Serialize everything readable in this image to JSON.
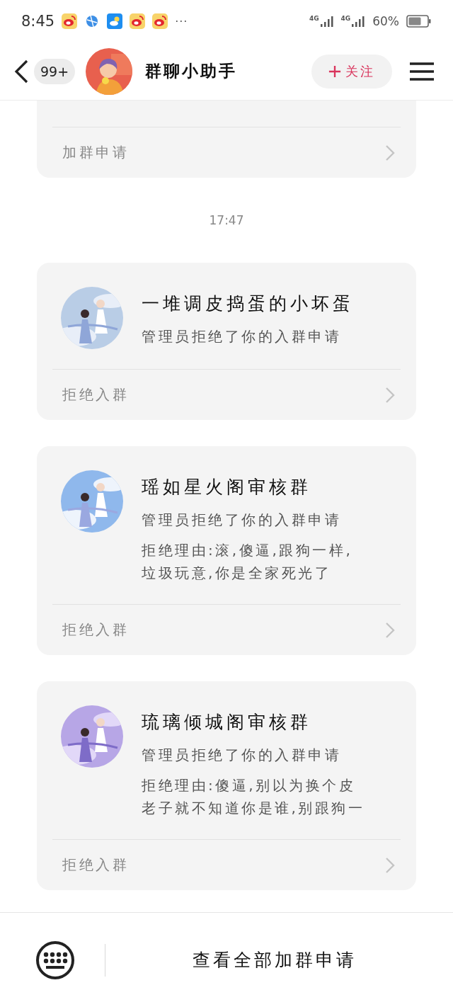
{
  "status_bar": {
    "time": "8:45",
    "notifications": [
      {
        "kind": "weibo"
      },
      {
        "kind": "browser"
      },
      {
        "kind": "weather"
      },
      {
        "kind": "weibo"
      },
      {
        "kind": "weibo"
      }
    ],
    "more": "···",
    "networks": [
      "4G",
      "4G"
    ],
    "battery": "60%"
  },
  "header": {
    "unread_badge": "99+",
    "title": "群聊小助手",
    "follow_button": "关注"
  },
  "feed": [
    {
      "kind": "card",
      "partial": true,
      "footer": "加群申请"
    },
    {
      "kind": "time",
      "text": "17:47"
    },
    {
      "kind": "card",
      "partial": false,
      "title": "一堆调皮捣蛋的小坏蛋",
      "subtitle": "管理员拒绝了你的入群申请",
      "footer": "拒绝入群"
    },
    {
      "kind": "card",
      "partial": false,
      "title": "瑶如星火阁审核群",
      "subtitle": "管理员拒绝了你的入群申请",
      "reason_lines": [
        "拒绝理由:滚,傻逼,跟狗一样,",
        "垃圾玩意,你是全家死光了"
      ],
      "footer": "拒绝入群"
    },
    {
      "kind": "card",
      "partial": false,
      "title": "琉璃倾城阁审核群",
      "subtitle": "管理员拒绝了你的入群申请",
      "reason_lines": [
        "拒绝理由:傻逼,别以为换个皮",
        "老子就不知道你是谁,别跟狗一"
      ],
      "footer": "拒绝入群"
    }
  ],
  "bottom_bar": {
    "action_button": "查看全部加群申请"
  }
}
